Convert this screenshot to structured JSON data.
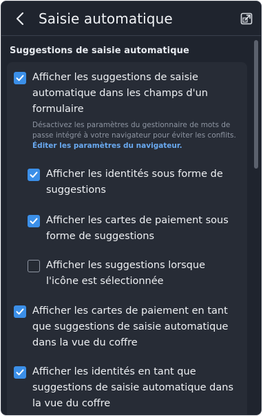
{
  "header": {
    "back_icon": "chevron-left-icon",
    "title": "Saisie automatique",
    "popout_icon": "popout-window-icon"
  },
  "section": {
    "heading": "Suggestions de saisie automatique"
  },
  "options": [
    {
      "label": "Afficher les suggestions de saisie automatique dans les champs d'un formulaire",
      "checked": true
    },
    {
      "label": "Afficher les identités sous forme de suggestions",
      "checked": true
    },
    {
      "label": "Afficher les cartes de paiement sous forme de suggestions",
      "checked": true
    },
    {
      "label": "Afficher les suggestions lorsque l'icône est sélectionnée",
      "checked": false
    },
    {
      "label": "Afficher les cartes de paiement en tant que suggestions de saisie automatique dans la vue du coffre",
      "checked": true
    },
    {
      "label": "Afficher les identités en tant que suggestions de saisie automatique dans la vue du coffre",
      "checked": true
    }
  ],
  "help": {
    "text": "Désactivez les paramètres du gestionnaire de mots de passe intégré à votre navigateur pour éviter les conflits.",
    "link": "Éditer les paramètres du navigateur."
  },
  "colors": {
    "background": "#1f242e",
    "card": "#272c36",
    "accent": "#3b8fe8",
    "link": "#69a9f0"
  }
}
